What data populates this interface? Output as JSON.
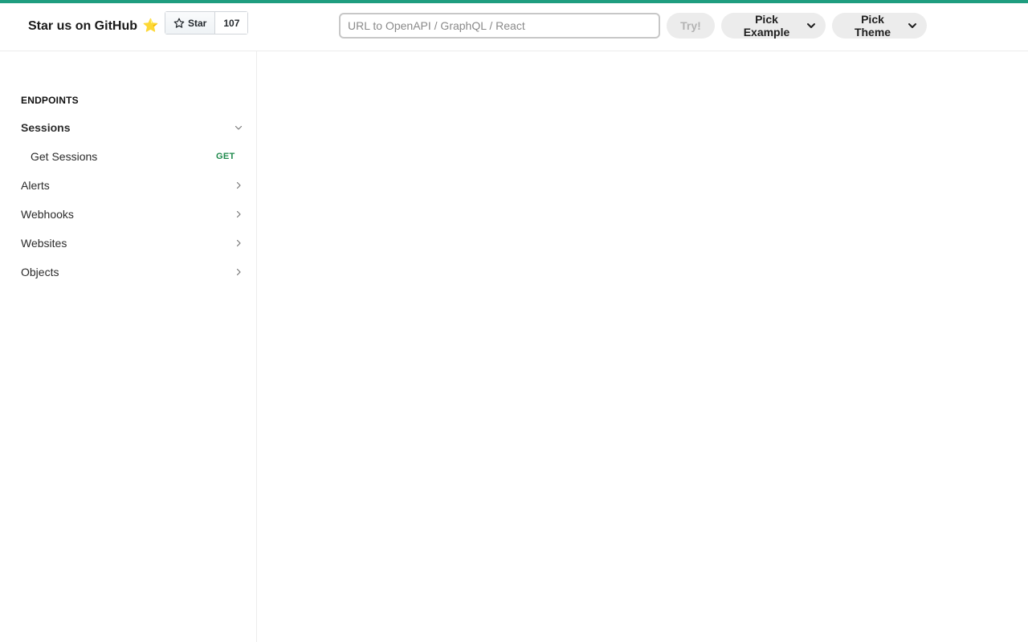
{
  "header": {
    "brand_title": "Star us on GitHub",
    "brand_emoji": "⭐",
    "github": {
      "star_label": "Star",
      "star_count": "107"
    },
    "url_input": {
      "placeholder": "URL to OpenAPI / GraphQL / React",
      "value": ""
    },
    "try_label": "Try!",
    "pick_example_label": "Pick Example",
    "pick_theme_label": "Pick Theme"
  },
  "sidebar": {
    "section_label": "ENDPOINTS",
    "groups": [
      {
        "label": "Sessions",
        "expanded": true,
        "icon": "chevron-down-icon",
        "items": [
          {
            "label": "Get Sessions",
            "method": "GET"
          }
        ]
      },
      {
        "label": "Alerts",
        "expanded": false,
        "icon": "chevron-right-icon"
      },
      {
        "label": "Webhooks",
        "expanded": false,
        "icon": "chevron-right-icon"
      },
      {
        "label": "Websites",
        "expanded": false,
        "icon": "chevron-right-icon"
      },
      {
        "label": "Objects",
        "expanded": false,
        "icon": "chevron-right-icon"
      }
    ]
  },
  "colors": {
    "accent_bar": "#1f9d7f",
    "get_method": "#1f8a4c",
    "button_bg": "#ececec"
  }
}
